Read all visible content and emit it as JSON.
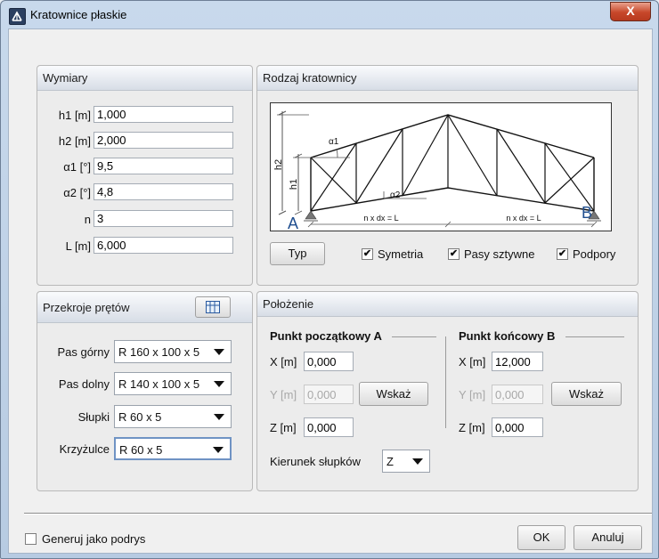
{
  "window": {
    "title": "Kratownice płaskie",
    "close_label": "X"
  },
  "wymiary": {
    "title": "Wymiary",
    "fields": [
      {
        "label": "h1 [m]",
        "value": "1,000"
      },
      {
        "label": "h2 [m]",
        "value": "2,000"
      },
      {
        "label": "α1 [°]",
        "value": "9,5"
      },
      {
        "label": "α2 [°]",
        "value": "4,8"
      },
      {
        "label": "n",
        "value": "3"
      },
      {
        "label": "L [m]",
        "value": "6,000"
      }
    ]
  },
  "rodzaj": {
    "title": "Rodzaj kratownicy",
    "diagram": {
      "label_a": "A",
      "label_b": "B",
      "label_h2": "h2",
      "label_h1": "h1",
      "label_alpha1": "α1",
      "label_alpha2": "α2",
      "dim_left": "n x dx = L",
      "dim_right": "n x dx = L"
    },
    "typ_button": "Typ",
    "checkboxes": [
      {
        "label": "Symetria",
        "checked": true
      },
      {
        "label": "Pasy sztywne",
        "checked": true
      },
      {
        "label": "Podpory",
        "checked": true
      }
    ],
    "check_mark": "✔"
  },
  "przekroje": {
    "title": "Przekroje prętów",
    "rows": [
      {
        "label": "Pas górny",
        "value": "R 160 x 100 x 5"
      },
      {
        "label": "Pas dolny",
        "value": "R 140 x 100 x 5"
      },
      {
        "label": "Słupki",
        "value": "R 60 x 5"
      },
      {
        "label": "Krzyżulce",
        "value": "R 60 x 5"
      }
    ]
  },
  "polozenie": {
    "title": "Położenie",
    "start": {
      "title": "Punkt początkowy A",
      "x_label": "X [m]",
      "x_value": "0,000",
      "y_label": "Y [m]",
      "y_value": "0,000",
      "z_label": "Z [m]",
      "z_value": "0,000",
      "button": "Wskaż"
    },
    "end": {
      "title": "Punkt końcowy B",
      "x_label": "X [m]",
      "x_value": "12,000",
      "y_label": "Y [m]",
      "y_value": "0,000",
      "z_label": "Z [m]",
      "z_value": "0,000",
      "button": "Wskaż"
    },
    "kierunek_label": "Kierunek słupków",
    "kierunek_value": "Z"
  },
  "footer": {
    "generuj_label": "Generuj jako podrys",
    "generuj_checked": false,
    "ok_label": "OK",
    "cancel_label": "Anuluj"
  }
}
